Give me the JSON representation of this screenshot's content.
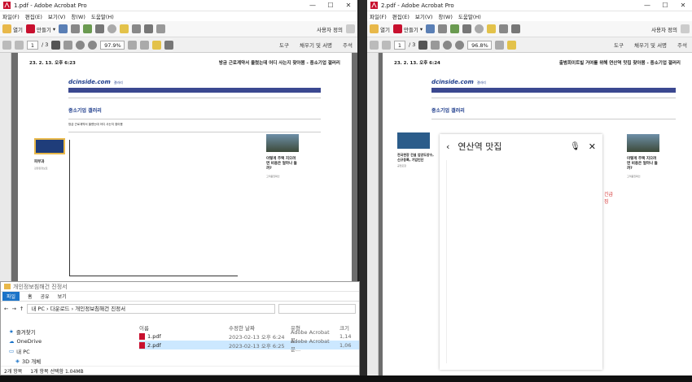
{
  "left_window": {
    "title": "1.pdf - Adobe Acrobat Pro",
    "menu": [
      "파일(F)",
      "편집(E)",
      "보기(V)",
      "창(W)",
      "도움말(H)"
    ],
    "customize": "사용자 정의",
    "toolbar": {
      "open": "열기",
      "create": "만들기"
    },
    "page_current": "1",
    "page_total": "/ 3",
    "zoom": "97.9%",
    "right_tools": [
      "도구",
      "채우기 및 서명",
      "주석"
    ],
    "doc": {
      "date": "23. 2. 13. 오후 6:23",
      "heading": "방금 근로계약서 올렸는데 어디 사는지 찾아봄 - 중소기업 갤러리",
      "site": "dcinside.com",
      "site_sub": "갤러리",
      "gallery_title": "중소기업 갤러리",
      "post_title": "방금 근로계약서 올렸는데 어디 사는지 찾아봄",
      "ad_text": "피부과",
      "ad_sub": "검정된정보로",
      "right_ad": "이렇게 주택 지으려면 비용은 얼마나 들까?",
      "right_ad_sub": "고객품질확인"
    }
  },
  "right_window": {
    "title": "2.pdf - Adobe Acrobat Pro",
    "menu": [
      "파일(F)",
      "편집(E)",
      "보기(V)",
      "창(W)",
      "도움말(H)"
    ],
    "customize": "사용자 정의",
    "toolbar": {
      "open": "열기",
      "create": "만들기"
    },
    "page_current": "1",
    "page_total": "/ 3",
    "zoom": "96.8%",
    "right_tools": [
      "도구",
      "채우기 및 서명",
      "주석"
    ],
    "doc": {
      "date": "23. 2. 13. 오후 6:24",
      "heading": "출범회이트빌 거여를 위해 연산역 맛집 찾아봄 - 중소기업 갤러리",
      "site": "dcinside.com",
      "site_sub": "갤러리",
      "gallery_title": "중소기업 갤러리",
      "left_ad": "전국현장 건설 업양도양수, 신규등록, 기업인단",
      "left_ad_sub": "공업포함",
      "right_ad": "이렇게 주택 지으려면 비용은 얼마나 들까?",
      "right_ad_sub": "고객품질확인",
      "map_search": "연산역 맛집",
      "right_edge": [
        "긴급",
        "징"
      ]
    }
  },
  "explorer": {
    "title": "개인정보침해건 진정서",
    "tabs": [
      "파일",
      "홈",
      "공유",
      "보기"
    ],
    "path": [
      "내 PC",
      "다운로드",
      "개인정보침해건 진정서"
    ],
    "nav": [
      "즐겨찾기",
      "OneDrive",
      "내 PC",
      "3D 개체"
    ],
    "columns": [
      "이름",
      "수정한 날짜",
      "유형",
      "크기"
    ],
    "files": [
      {
        "name": "1.pdf",
        "date": "2023-02-13 오후 6:24",
        "type": "Adobe Acrobat 문...",
        "size": "1,14"
      },
      {
        "name": "2.pdf",
        "date": "2023-02-13 오후 6:25",
        "type": "Adobe Acrobat 문...",
        "size": "1,06"
      }
    ],
    "status_count": "2개 항목",
    "status_selected": "1개 항목 선택함 1.04MB"
  },
  "colors": {
    "acrobat_red": "#c8102e",
    "dc_blue": "#3b4890",
    "select": "#cce8ff"
  }
}
